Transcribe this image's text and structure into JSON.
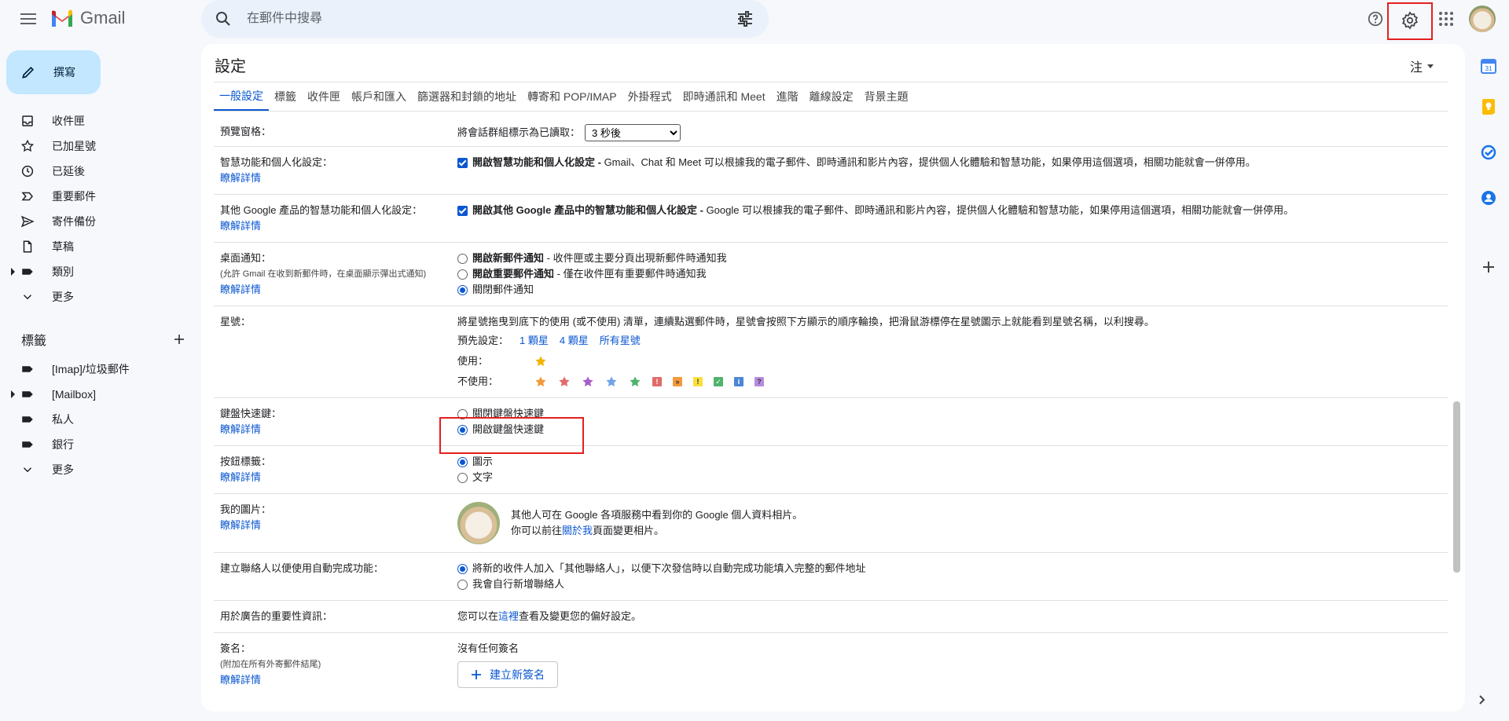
{
  "app": {
    "name": "Gmail"
  },
  "search": {
    "placeholder": "在郵件中搜尋"
  },
  "compose": {
    "label": "撰寫"
  },
  "nav": {
    "items": [
      {
        "label": "收件匣",
        "icon": "inbox-icon"
      },
      {
        "label": "已加星號",
        "icon": "star-icon"
      },
      {
        "label": "已延後",
        "icon": "clock-icon"
      },
      {
        "label": "重要郵件",
        "icon": "important-icon"
      },
      {
        "label": "寄件備份",
        "icon": "send-icon"
      },
      {
        "label": "草稿",
        "icon": "draft-icon"
      },
      {
        "label": "類別",
        "icon": "label-icon"
      },
      {
        "label": "更多",
        "icon": "chevron-down-icon"
      }
    ]
  },
  "labels": {
    "heading": "標籤",
    "items": [
      {
        "label": "[Imap]/垃圾郵件"
      },
      {
        "label": "[Mailbox]"
      },
      {
        "label": "私人"
      },
      {
        "label": "銀行"
      },
      {
        "label": "更多"
      }
    ]
  },
  "settings": {
    "title": "設定",
    "note": "注",
    "tabs": [
      "一般設定",
      "標籤",
      "收件匣",
      "帳戶和匯入",
      "篩選器和封鎖的地址",
      "轉寄和 POP/IMAP",
      "外掛程式",
      "即時通訊和 Meet",
      "進階",
      "離線設定",
      "背景主題"
    ],
    "learn_more": "瞭解詳情",
    "preview": {
      "label": "預覽窗格：",
      "text": "將會話群組標示為已讀取：",
      "selected": "3 秒後"
    },
    "smart": {
      "label": "智慧功能和個人化設定：",
      "bold": "開啟智慧功能和個人化設定 - ",
      "text": "Gmail、Chat 和 Meet 可以根據我的電子郵件、即時通訊和影片內容，提供個人化體驗和智慧功能，如果停用這個選項，相關功能就會一併停用。"
    },
    "other_smart": {
      "label": "其他 Google 產品的智慧功能和個人化設定：",
      "bold": "開啟其他 Google 產品中的智慧功能和個人化設定 - ",
      "text": "Google 可以根據我的電子郵件、即時通訊和影片內容，提供個人化體驗和智慧功能，如果停用這個選項，相關功能就會一併停用。"
    },
    "desktop": {
      "label": "桌面通知：",
      "sub": "(允許 Gmail 在收到新郵件時，在桌面顯示彈出式通知)",
      "opt1_bold": "開啟新郵件通知",
      "opt1_text": " - 收件匣或主要分頁出現新郵件時通知我",
      "opt2_bold": "開啟重要郵件通知",
      "opt2_text": " - 僅在收件匣有重要郵件時通知我",
      "opt3": "關閉郵件通知"
    },
    "stars": {
      "label": "星號：",
      "text": "將星號拖曳到底下的使用 (或不使用) 清單，連續點選郵件時，星號會按照下方顯示的順序輪換，把滑鼠游標停在星號圖示上就能看到星號名稱，以利搜尋。",
      "presets_label": "預先設定：",
      "preset1": "1 顆星",
      "preset2": "4 顆星",
      "preset3": "所有星號",
      "in_use": "使用：",
      "not_in_use": "不使用："
    },
    "shortcuts": {
      "label": "鍵盤快速鍵：",
      "opt1": "關閉鍵盤快速鍵",
      "opt2": "開啟鍵盤快速鍵"
    },
    "button_labels": {
      "label": "按鈕標籤：",
      "opt1": "圖示",
      "opt2": "文字"
    },
    "picture": {
      "label": "我的圖片：",
      "line1": "其他人可在 Google 各項服務中看到你的 Google 個人資料相片。",
      "line2_pre": "你可以前往",
      "line2_link": "關於我",
      "line2_post": "頁面變更相片。"
    },
    "contacts": {
      "label": "建立聯絡人以便使用自動完成功能：",
      "opt1": "將新的收件人加入「其他聯絡人」，以便下次發信時以自動完成功能填入完整的郵件地址",
      "opt2": "我會自行新增聯絡人"
    },
    "ads": {
      "label": "用於廣告的重要性資訊：",
      "pre": "您可以在",
      "link": "這裡",
      "post": "查看及變更您的偏好設定。"
    },
    "signature": {
      "label": "簽名：",
      "sub": "(附加在所有外寄郵件結尾)",
      "none": "沒有任何簽名",
      "button": "建立新簽名"
    }
  },
  "colors": {
    "accent": "#0b57d0",
    "highlight": "#e51f1f",
    "compose_bg": "#c2e7ff"
  }
}
